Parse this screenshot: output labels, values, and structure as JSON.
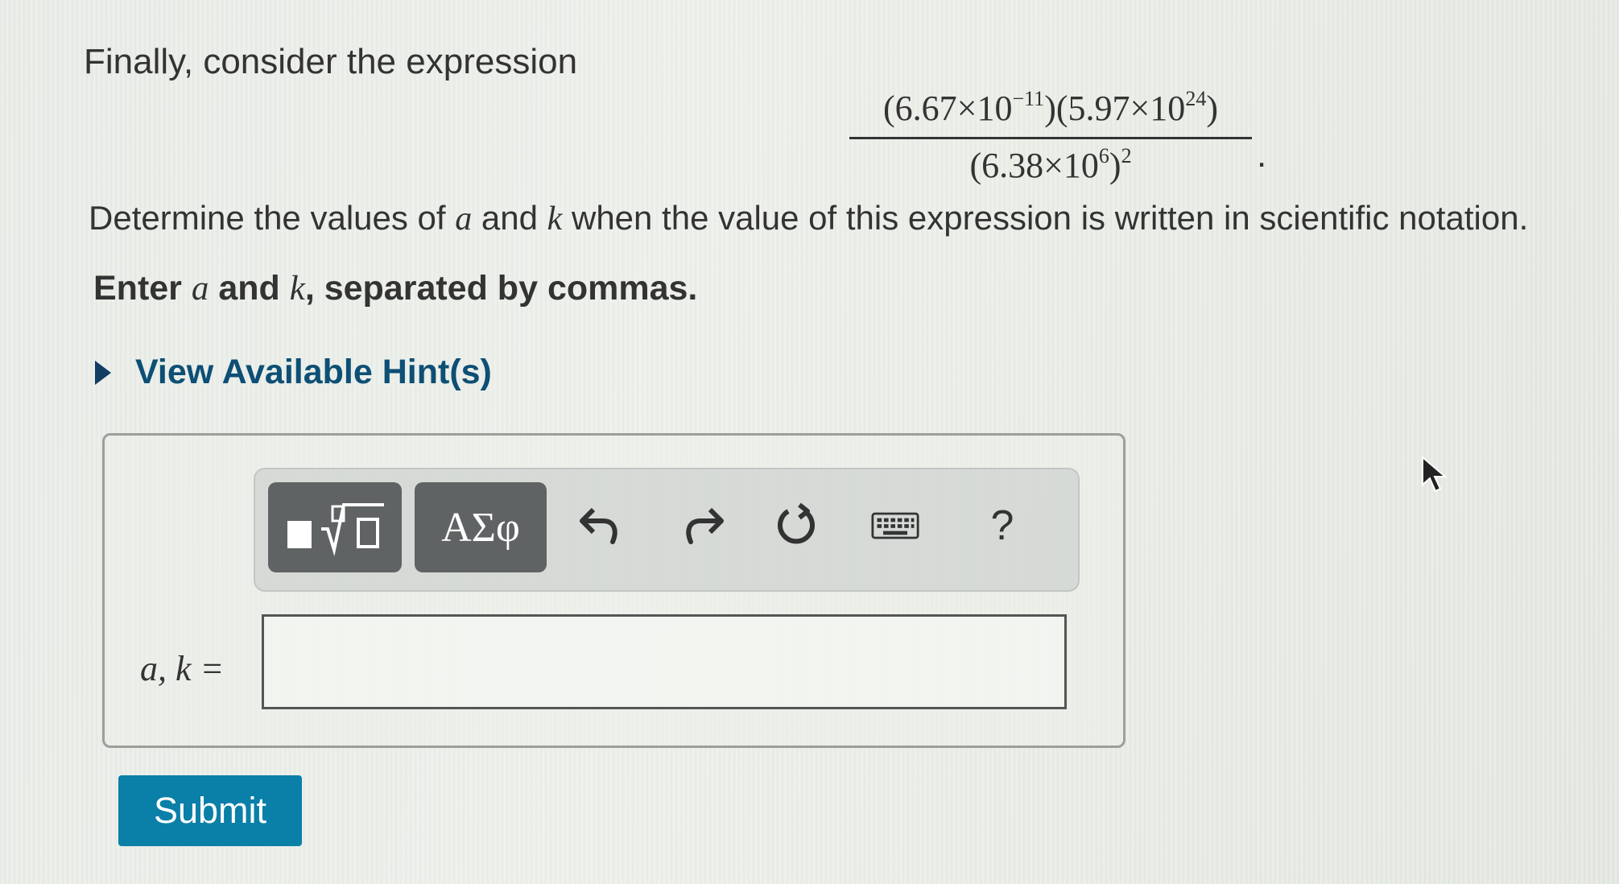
{
  "question": {
    "intro": "Finally, consider the expression",
    "expression": {
      "numerator": {
        "factor1_base": "(6.67×10",
        "factor1_exp": "−11",
        "factor1_close": ")",
        "factor2_base": "(5.97×10",
        "factor2_exp": "24",
        "factor2_close": ")"
      },
      "denominator": {
        "base": "(6.38×10",
        "inner_exp": "6",
        "close": ")",
        "outer_exp": "2"
      },
      "trailing": "."
    },
    "prompt": {
      "pre": "Determine the values of ",
      "var1": "a",
      "mid": " and ",
      "var2": "k",
      "post": " when the value of this expression is written in scientific notation."
    },
    "instruction": {
      "pre": "Enter ",
      "var1": "a",
      "mid": " and ",
      "var2": "k",
      "post": ", separated by commas."
    }
  },
  "hint": {
    "label": "View Available Hint(s)"
  },
  "toolbar": {
    "greek_label": "ΑΣφ",
    "help_label": "?",
    "icons": [
      "templates-icon",
      "undo-icon",
      "redo-icon",
      "reset-icon",
      "keyboard-icon",
      "help-icon"
    ]
  },
  "answer": {
    "label": "a, k =",
    "value": ""
  },
  "submit": {
    "label": "Submit",
    "color": "#0a7fa8"
  }
}
